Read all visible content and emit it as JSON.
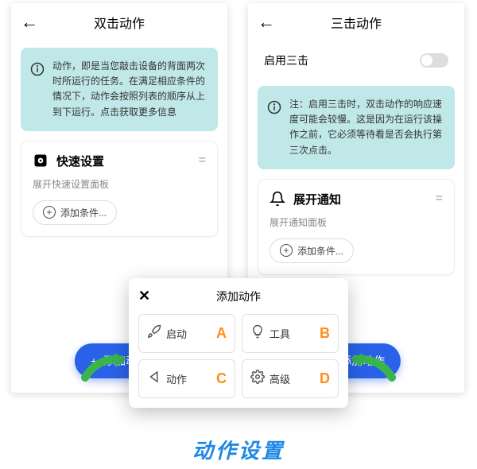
{
  "left": {
    "title": "双击动作",
    "info": "动作，即是当您敲击设备的背面两次时所运行的任务。在满足相应条件的情况下，动作会按照列表的顺序从上到下运行。点击获取更多信息",
    "card": {
      "title": "快速设置",
      "sub": "展开快速设置面板"
    },
    "addCond": "添加条件...",
    "fab": "添加动作"
  },
  "right": {
    "title": "三击动作",
    "toggle": "启用三击",
    "info": "注：启用三击时，双击动作的响应速度可能会较慢。这是因为在运行该操作之前，它必须等待看是否会执行第三次点击。",
    "card": {
      "title": "展开通知",
      "sub": "展开通知面板"
    },
    "addCond": "添加条件...",
    "fab": "添加动作"
  },
  "dialog": {
    "title": "添加动作",
    "items": [
      {
        "label": "启动",
        "tag": "A"
      },
      {
        "label": "工具",
        "tag": "B"
      },
      {
        "label": "动作",
        "tag": "C"
      },
      {
        "label": "高级",
        "tag": "D"
      }
    ]
  },
  "footer": "动作设置"
}
